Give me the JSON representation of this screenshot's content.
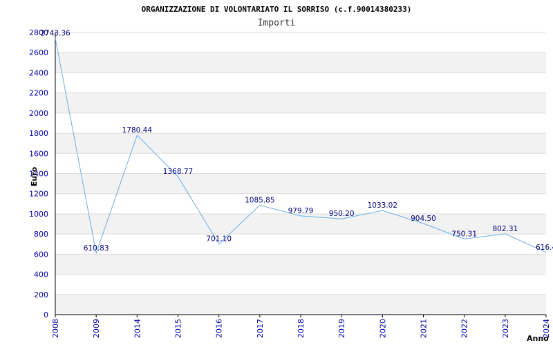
{
  "chart_data": {
    "type": "line",
    "title": "ORGANIZZAZIONE DI VOLONTARIATO IL SORRISO (c.f.90014380233)",
    "subtitle": "Importi",
    "ylabel": "Euro",
    "xlabel": "Anno",
    "categories": [
      "2008",
      "2009",
      "2014",
      "2015",
      "2016",
      "2017",
      "2018",
      "2019",
      "2020",
      "2021",
      "2022",
      "2023",
      "2024"
    ],
    "series": [
      {
        "values": [
          2743.36,
          610.83,
          1780.44,
          1368.77,
          701.1,
          1085.85,
          979.79,
          950.2,
          1033.02,
          904.5,
          750.31,
          802.31,
          616.4
        ],
        "labels": [
          "2743.36",
          "610.83",
          "1780.44",
          "1368.77",
          "701.10",
          "1085.85",
          "979.79",
          "950.20",
          "1033.02",
          "904.50",
          "750.31",
          "802.31",
          "616.4"
        ]
      }
    ],
    "ylim": [
      0,
      2800
    ],
    "yticks": [
      "0",
      "200",
      "400",
      "600",
      "800",
      "1000",
      "1200",
      "1400",
      "1600",
      "1800",
      "2000",
      "2200",
      "2400",
      "2600",
      "2800"
    ],
    "grid": true,
    "colors": {
      "line": "#6aaee8",
      "band": "#f2f2f2",
      "axis": "#000000",
      "tick_text": "#0000aa",
      "label_text": "#000080"
    }
  }
}
